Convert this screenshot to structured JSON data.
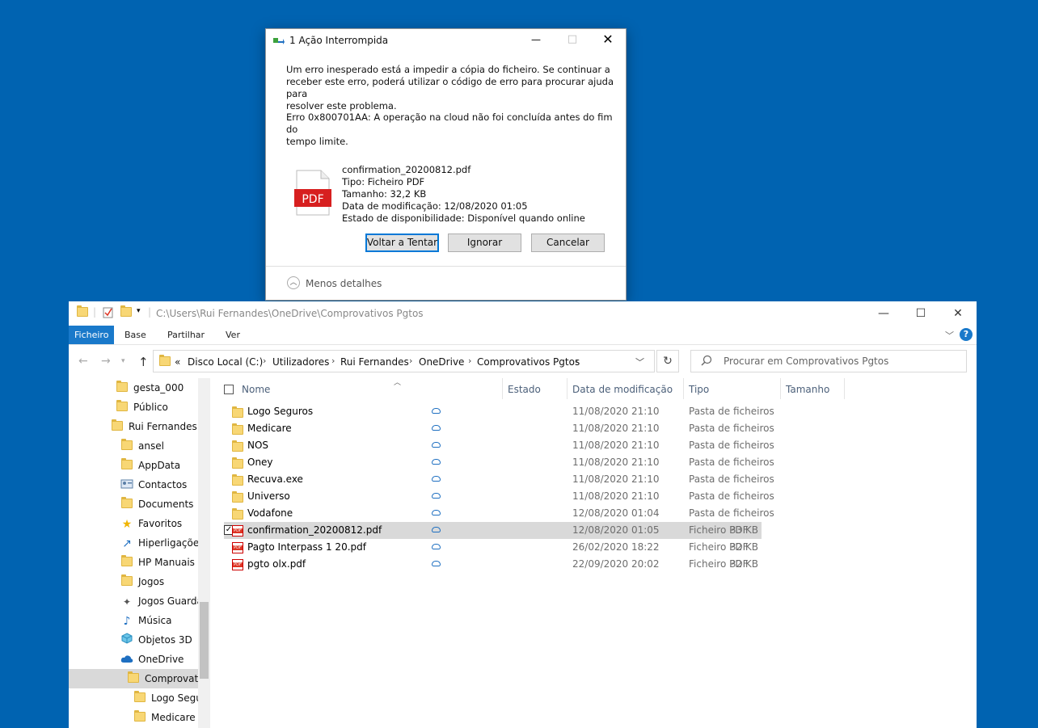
{
  "dialog": {
    "title": "1 Ação Interrompida",
    "message": "Um erro inesperado está a impedir a cópia do ficheiro. Se continuar a receber este erro, poderá utilizar o código de erro para procurar ajuda para resolver este problema.",
    "message_lines": [
      "Um erro inesperado está a impedir a cópia do ficheiro. Se continuar a",
      "receber este erro, poderá utilizar o código de erro para procurar ajuda para",
      "resolver este problema."
    ],
    "error_lines": [
      "Erro 0x800701AA: A operação na cloud não foi concluída antes do fim do",
      "tempo limite."
    ],
    "file": {
      "name": "confirmation_20200812.pdf",
      "type": "Tipo: Ficheiro PDF",
      "size": "Tamanho: 32,2 KB",
      "modified": "Data de modificação: 12/08/2020 01:05",
      "availability": "Estado de disponibilidade: Disponível quando online",
      "icon_label": "PDF"
    },
    "buttons": {
      "retry": "Voltar a Tentar",
      "ignore": "Ignorar",
      "cancel": "Cancelar"
    },
    "less_details": "Menos detalhes"
  },
  "explorer": {
    "title_path": "C:\\Users\\Rui Fernandes\\OneDrive\\Comprovativos Pgtos",
    "ribbon_tabs": [
      "Ficheiro",
      "Base",
      "Partilhar",
      "Ver"
    ],
    "breadcrumb": [
      "Disco Local (C:)",
      "Utilizadores",
      "Rui Fernandes",
      "OneDrive",
      "Comprovativos Pgtos"
    ],
    "breadcrumb_overflow": "«",
    "search_placeholder": "Procurar em Comprovativos Pgtos",
    "nav_items": [
      {
        "label": "gesta_000",
        "icon": "folder-icon"
      },
      {
        "label": "Público",
        "icon": "folder-icon"
      },
      {
        "label": "Rui Fernandes",
        "icon": "folder-icon"
      },
      {
        "label": "ansel",
        "icon": "folder-icon"
      },
      {
        "label": "AppData",
        "icon": "folder-icon"
      },
      {
        "label": "Contactos",
        "icon": "contacts-icon"
      },
      {
        "label": "Documents",
        "icon": "folder-icon"
      },
      {
        "label": "Favoritos",
        "icon": "star-icon"
      },
      {
        "label": "Hiperligações",
        "icon": "link-icon"
      },
      {
        "label": "HP Manuais",
        "icon": "folder-icon"
      },
      {
        "label": "Jogos",
        "icon": "folder-icon"
      },
      {
        "label": "Jogos Guardad",
        "icon": "games-icon"
      },
      {
        "label": "Música",
        "icon": "music-icon"
      },
      {
        "label": "Objetos 3D",
        "icon": "cube-icon"
      },
      {
        "label": "OneDrive",
        "icon": "cloud-icon"
      },
      {
        "label": "Comprovativ",
        "icon": "folder-icon"
      },
      {
        "label": "Logo Segur",
        "icon": "folder-icon"
      },
      {
        "label": "Medicare",
        "icon": "folder-icon"
      }
    ],
    "columns": {
      "name": "Nome",
      "status": "Estado",
      "modified": "Data de modificação",
      "type": "Tipo",
      "size": "Tamanho"
    },
    "files": [
      {
        "name": "Logo Seguros",
        "modified": "11/08/2020 21:10",
        "type": "Pasta de ficheiros",
        "size": "",
        "kind": "folder"
      },
      {
        "name": "Medicare",
        "modified": "11/08/2020 21:10",
        "type": "Pasta de ficheiros",
        "size": "",
        "kind": "folder"
      },
      {
        "name": "NOS",
        "modified": "11/08/2020 21:10",
        "type": "Pasta de ficheiros",
        "size": "",
        "kind": "folder"
      },
      {
        "name": "Oney",
        "modified": "11/08/2020 21:10",
        "type": "Pasta de ficheiros",
        "size": "",
        "kind": "folder"
      },
      {
        "name": "Recuva.exe",
        "modified": "11/08/2020 21:10",
        "type": "Pasta de ficheiros",
        "size": "",
        "kind": "folder"
      },
      {
        "name": "Universo",
        "modified": "11/08/2020 21:10",
        "type": "Pasta de ficheiros",
        "size": "",
        "kind": "folder"
      },
      {
        "name": "Vodafone",
        "modified": "12/08/2020 01:04",
        "type": "Pasta de ficheiros",
        "size": "",
        "kind": "folder"
      },
      {
        "name": "confirmation_20200812.pdf",
        "modified": "12/08/2020 01:05",
        "type": "Ficheiro PDF",
        "size": "33 KB",
        "kind": "pdf",
        "selected": true
      },
      {
        "name": "Pagto Interpass 1 20.pdf",
        "modified": "26/02/2020 18:22",
        "type": "Ficheiro PDF",
        "size": "32 KB",
        "kind": "pdf"
      },
      {
        "name": "pgto olx.pdf",
        "modified": "22/09/2020 20:02",
        "type": "Ficheiro PDF",
        "size": "32 KB",
        "kind": "pdf"
      }
    ]
  }
}
